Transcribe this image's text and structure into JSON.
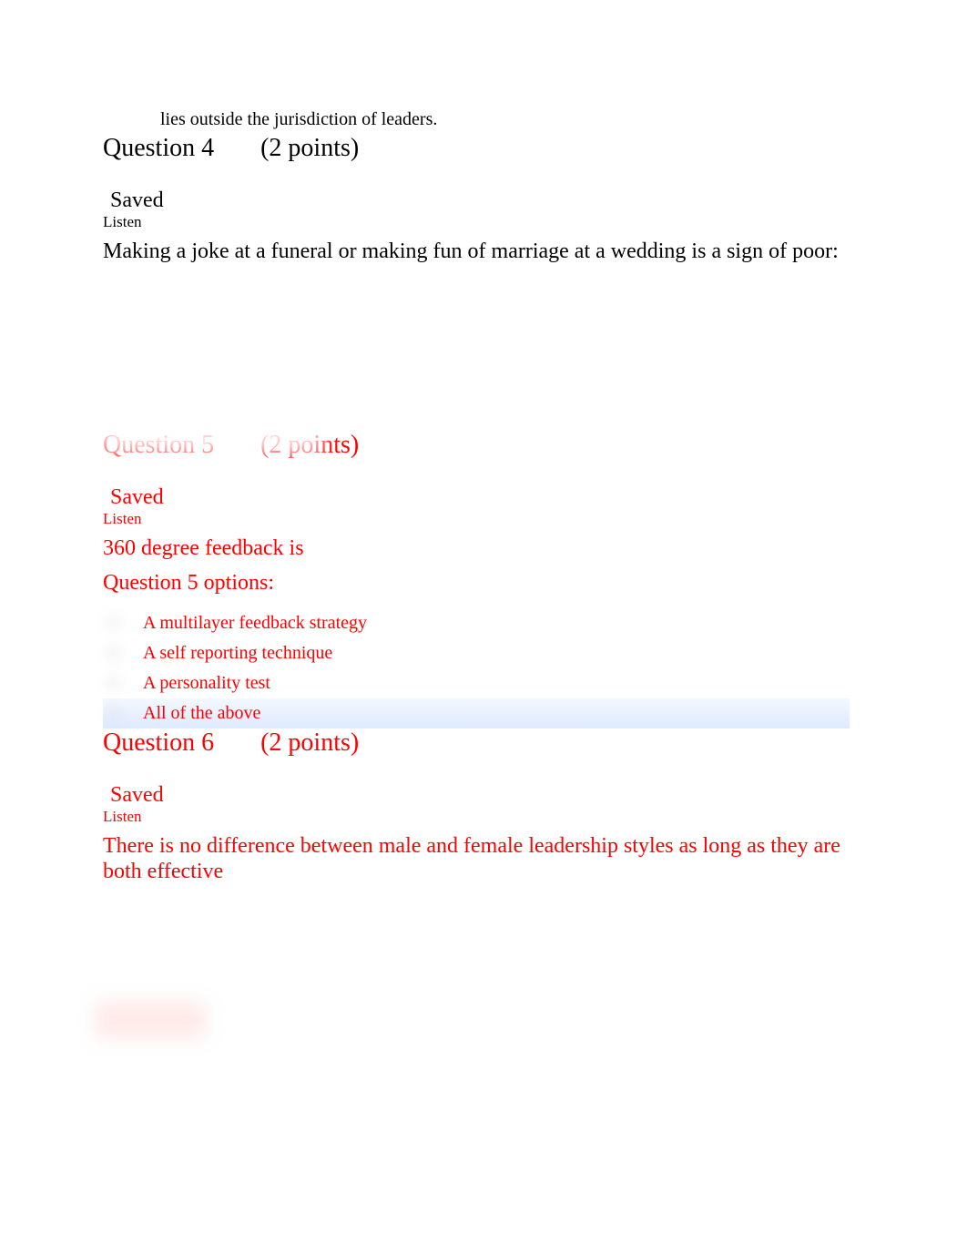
{
  "fragment": "lies outside the jurisdiction of leaders.",
  "q4": {
    "number": "Question 4",
    "points": "(2 points)",
    "saved": "Saved",
    "listen": "Listen",
    "text": "Making a joke at a funeral or making fun of marriage at a wedding is a sign of poor:"
  },
  "q5": {
    "number": "Question 5",
    "points": "(2 points)",
    "saved": "Saved",
    "listen": "Listen",
    "text": "360 degree feedback is",
    "options_label": "Question 5 options:",
    "options": [
      "A multilayer feedback strategy",
      "A self reporting technique",
      "A personality test",
      "All of the above"
    ]
  },
  "q6": {
    "number": "Question 6",
    "points": "(2 points)",
    "saved": "Saved",
    "listen": "Listen",
    "text": "There is no difference between male and female leadership styles as long as they are both effective"
  }
}
